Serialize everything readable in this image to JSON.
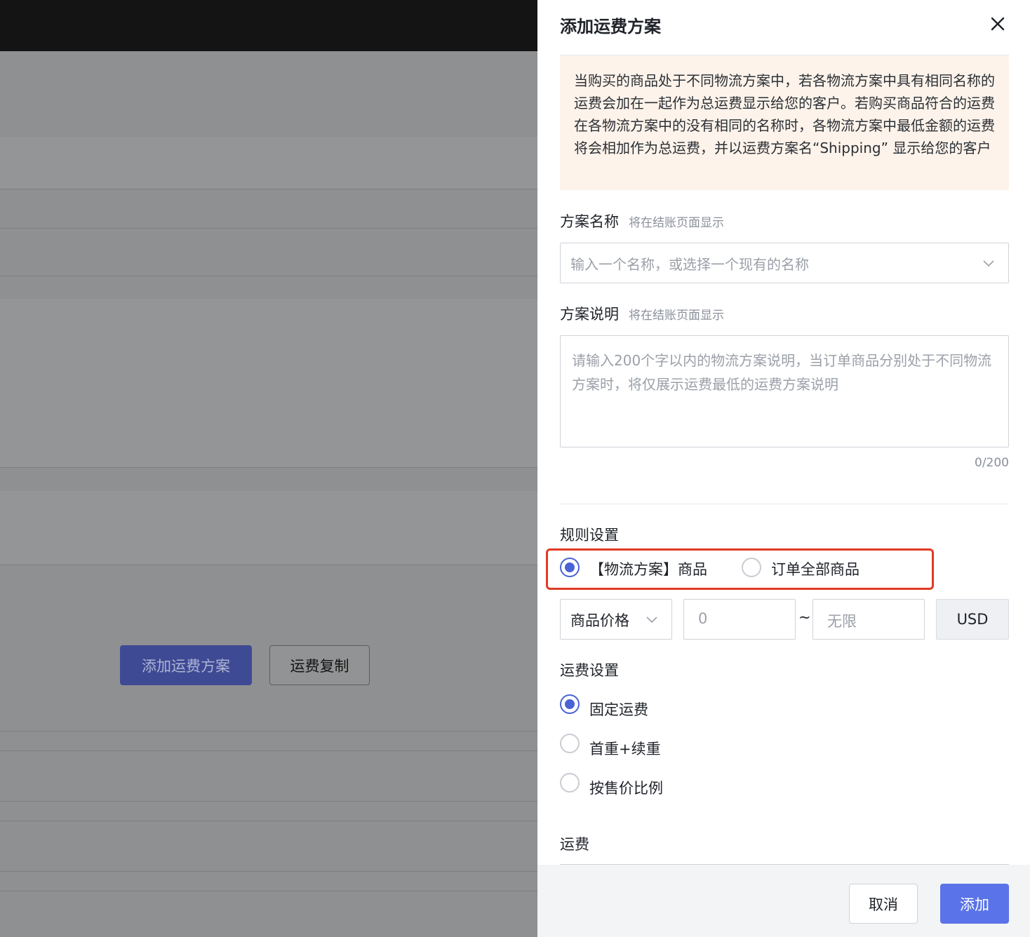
{
  "background": {
    "add_plan_button": "添加运费方案",
    "copy_button": "运费复制"
  },
  "drawer": {
    "title": "添加运费方案",
    "notice": "当购买的商品处于不同物流方案中，若各物流方案中具有相同名称的运费会加在一起作为总运费显示给您的客户。若购买商品符合的运费在各物流方案中的没有相同的名称时，各物流方案中最低金额的运费将会相加作为总运费，并以运费方案名“Shipping” 显示给您的客户",
    "plan_name": {
      "label": "方案名称",
      "hint": "将在结账页面显示",
      "placeholder": "输入一个名称，或选择一个现有的名称"
    },
    "plan_desc": {
      "label": "方案说明",
      "hint": "将在结账页面显示",
      "placeholder": "请输入200个字以内的物流方案说明，当订单商品分别处于不同物流方案时，将仅展示运费最低的运费方案说明",
      "counter": "0/200"
    },
    "rules": {
      "label": "规则设置",
      "options": [
        {
          "label": "【物流方案】商品",
          "checked": true
        },
        {
          "label": "订单全部商品",
          "checked": false
        }
      ],
      "condition": "商品价格",
      "min_placeholder": "0",
      "separator": "~",
      "max_placeholder": "无限",
      "currency": "USD"
    },
    "fee_settings": {
      "label": "运费设置",
      "options": [
        {
          "label": "固定运费",
          "checked": true
        },
        {
          "label": "首重+续重",
          "checked": false
        },
        {
          "label": "按售价比例",
          "checked": false
        }
      ]
    },
    "fee_label": "运费",
    "footer": {
      "cancel": "取消",
      "add": "添加"
    }
  },
  "colors": {
    "primary": "#5a73e8",
    "radio_checked": "#4a63d6",
    "notice_bg": "#fdf3ea",
    "highlight": "#e03a26"
  }
}
